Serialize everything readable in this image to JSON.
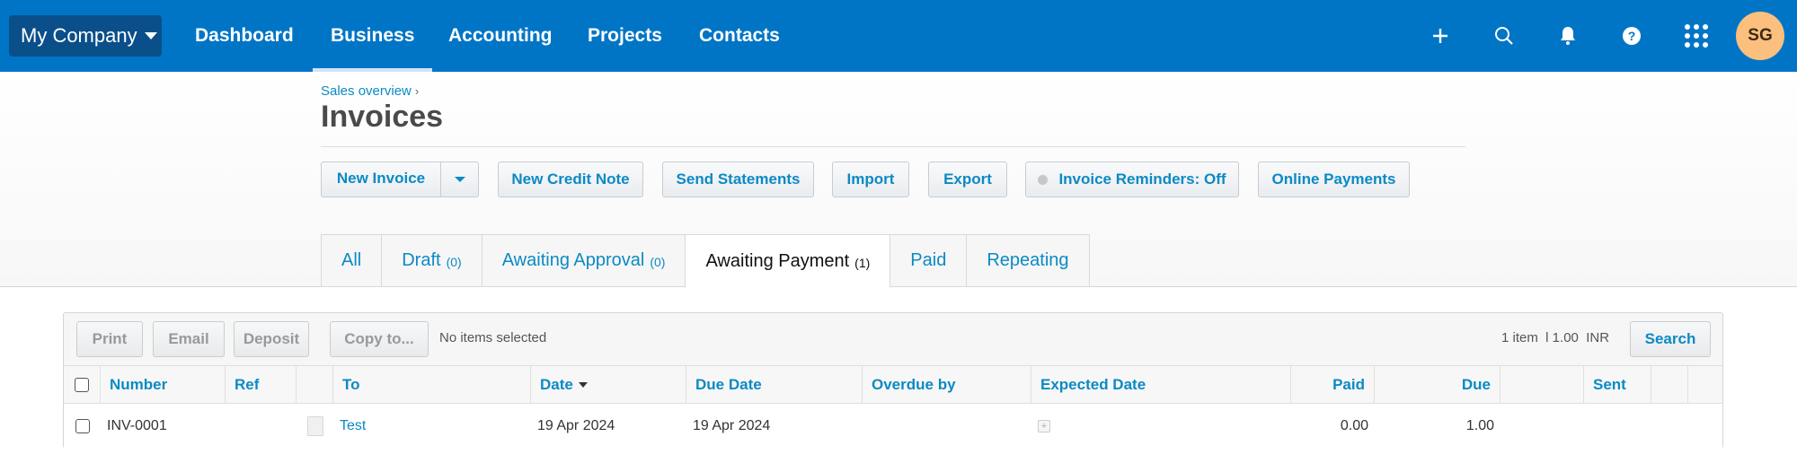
{
  "topnav": {
    "org_name": "My Company",
    "links": [
      {
        "label": "Dashboard",
        "active": false
      },
      {
        "label": "Business",
        "active": true
      },
      {
        "label": "Accounting",
        "active": false
      },
      {
        "label": "Projects",
        "active": false
      },
      {
        "label": "Contacts",
        "active": false
      }
    ],
    "icons": [
      "plus-icon",
      "search-icon",
      "bell-icon",
      "help-icon",
      "apps-grid-icon"
    ],
    "avatar_initials": "SG"
  },
  "header": {
    "breadcrumb": "Sales overview",
    "breadcrumb_sep": "›",
    "title": "Invoices"
  },
  "actions": {
    "new_invoice": "New Invoice",
    "new_credit_note": "New Credit Note",
    "send_statements": "Send Statements",
    "import": "Import",
    "export": "Export",
    "invoice_reminders": "Invoice Reminders: Off",
    "online_payments": "Online Payments"
  },
  "tabs": [
    {
      "label": "All",
      "count": null,
      "active": false
    },
    {
      "label": "Draft",
      "count": "(0)",
      "active": false
    },
    {
      "label": "Awaiting Approval",
      "count": "(0)",
      "active": false
    },
    {
      "label": "Awaiting Payment",
      "count": "(1)",
      "active": true
    },
    {
      "label": "Paid",
      "count": null,
      "active": false
    },
    {
      "label": "Repeating",
      "count": null,
      "active": false
    }
  ],
  "toolbar": {
    "print": "Print",
    "email": "Email",
    "deposit": "Deposit",
    "copy_to": "Copy to...",
    "selection_status": "No items selected",
    "summary": "1 item  l 1.00  INR",
    "search": "Search"
  },
  "table": {
    "columns": {
      "number": "Number",
      "ref": "Ref",
      "to": "To",
      "date": "Date",
      "due_date": "Due Date",
      "overdue_by": "Overdue by",
      "expected_date": "Expected Date",
      "paid": "Paid",
      "due": "Due",
      "sent": "Sent"
    },
    "rows": [
      {
        "number": "INV-0001",
        "ref": "",
        "to": "Test",
        "date": "19 Apr 2024",
        "due_date": "19 Apr 2024",
        "overdue_by": "",
        "expected_date_action": "+",
        "paid": "0.00",
        "due": "1.00",
        "sent": ""
      }
    ]
  }
}
